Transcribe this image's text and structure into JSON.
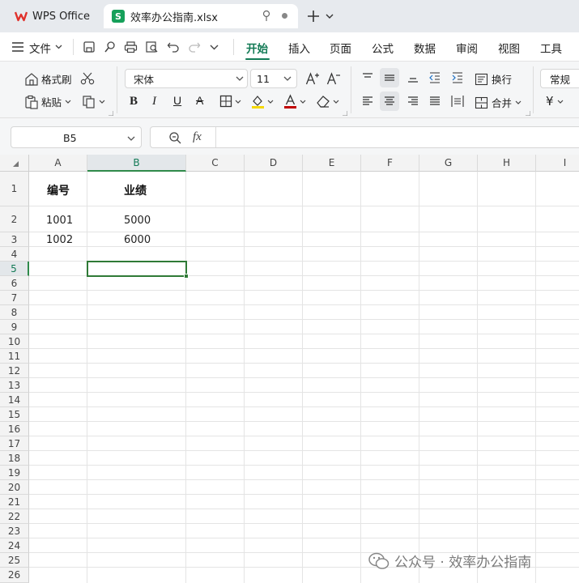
{
  "titlebar": {
    "app_tab_label": "WPS Office",
    "file_tab_label": "效率办公指南.xlsx",
    "sheet_icon_letter": "S"
  },
  "menubar": {
    "file_label": "文件",
    "tabs": [
      "开始",
      "插入",
      "页面",
      "公式",
      "数据",
      "审阅",
      "视图",
      "工具"
    ],
    "active_tab": "开始",
    "accent_color": "#127a55"
  },
  "ribbon": {
    "format_painter_label": "格式刷",
    "paste_label": "粘贴",
    "font_name": "宋体",
    "font_size": "11",
    "wrap_label": "换行",
    "merge_label": "合并",
    "number_format": "常规",
    "currency_symbol": "¥",
    "font_color": "#c00000",
    "highlight_color": "#f5d800"
  },
  "formula_bar": {
    "name_box": "B5",
    "fx_label": "fx",
    "formula_value": ""
  },
  "sheet": {
    "columns": [
      "A",
      "B",
      "C",
      "D",
      "E",
      "F",
      "G",
      "H",
      "I"
    ],
    "selected_column": "B",
    "rows": [
      "1",
      "2",
      "3",
      "4",
      "5",
      "6",
      "7",
      "8",
      "9",
      "10",
      "11",
      "12",
      "13",
      "14",
      "15",
      "16",
      "17",
      "18",
      "19",
      "20",
      "21",
      "22",
      "23",
      "24",
      "25",
      "26"
    ],
    "selected_row": "5",
    "selected_cell": "B5",
    "selection_color": "#2f7a36",
    "cells": {
      "A1": "编号",
      "B1": "业绩",
      "A2": "1001",
      "B2": "5000",
      "A3": "1002",
      "B3": "6000"
    }
  },
  "watermark": {
    "text": "公众号 · 效率办公指南",
    "icon": "wechat-icon"
  }
}
